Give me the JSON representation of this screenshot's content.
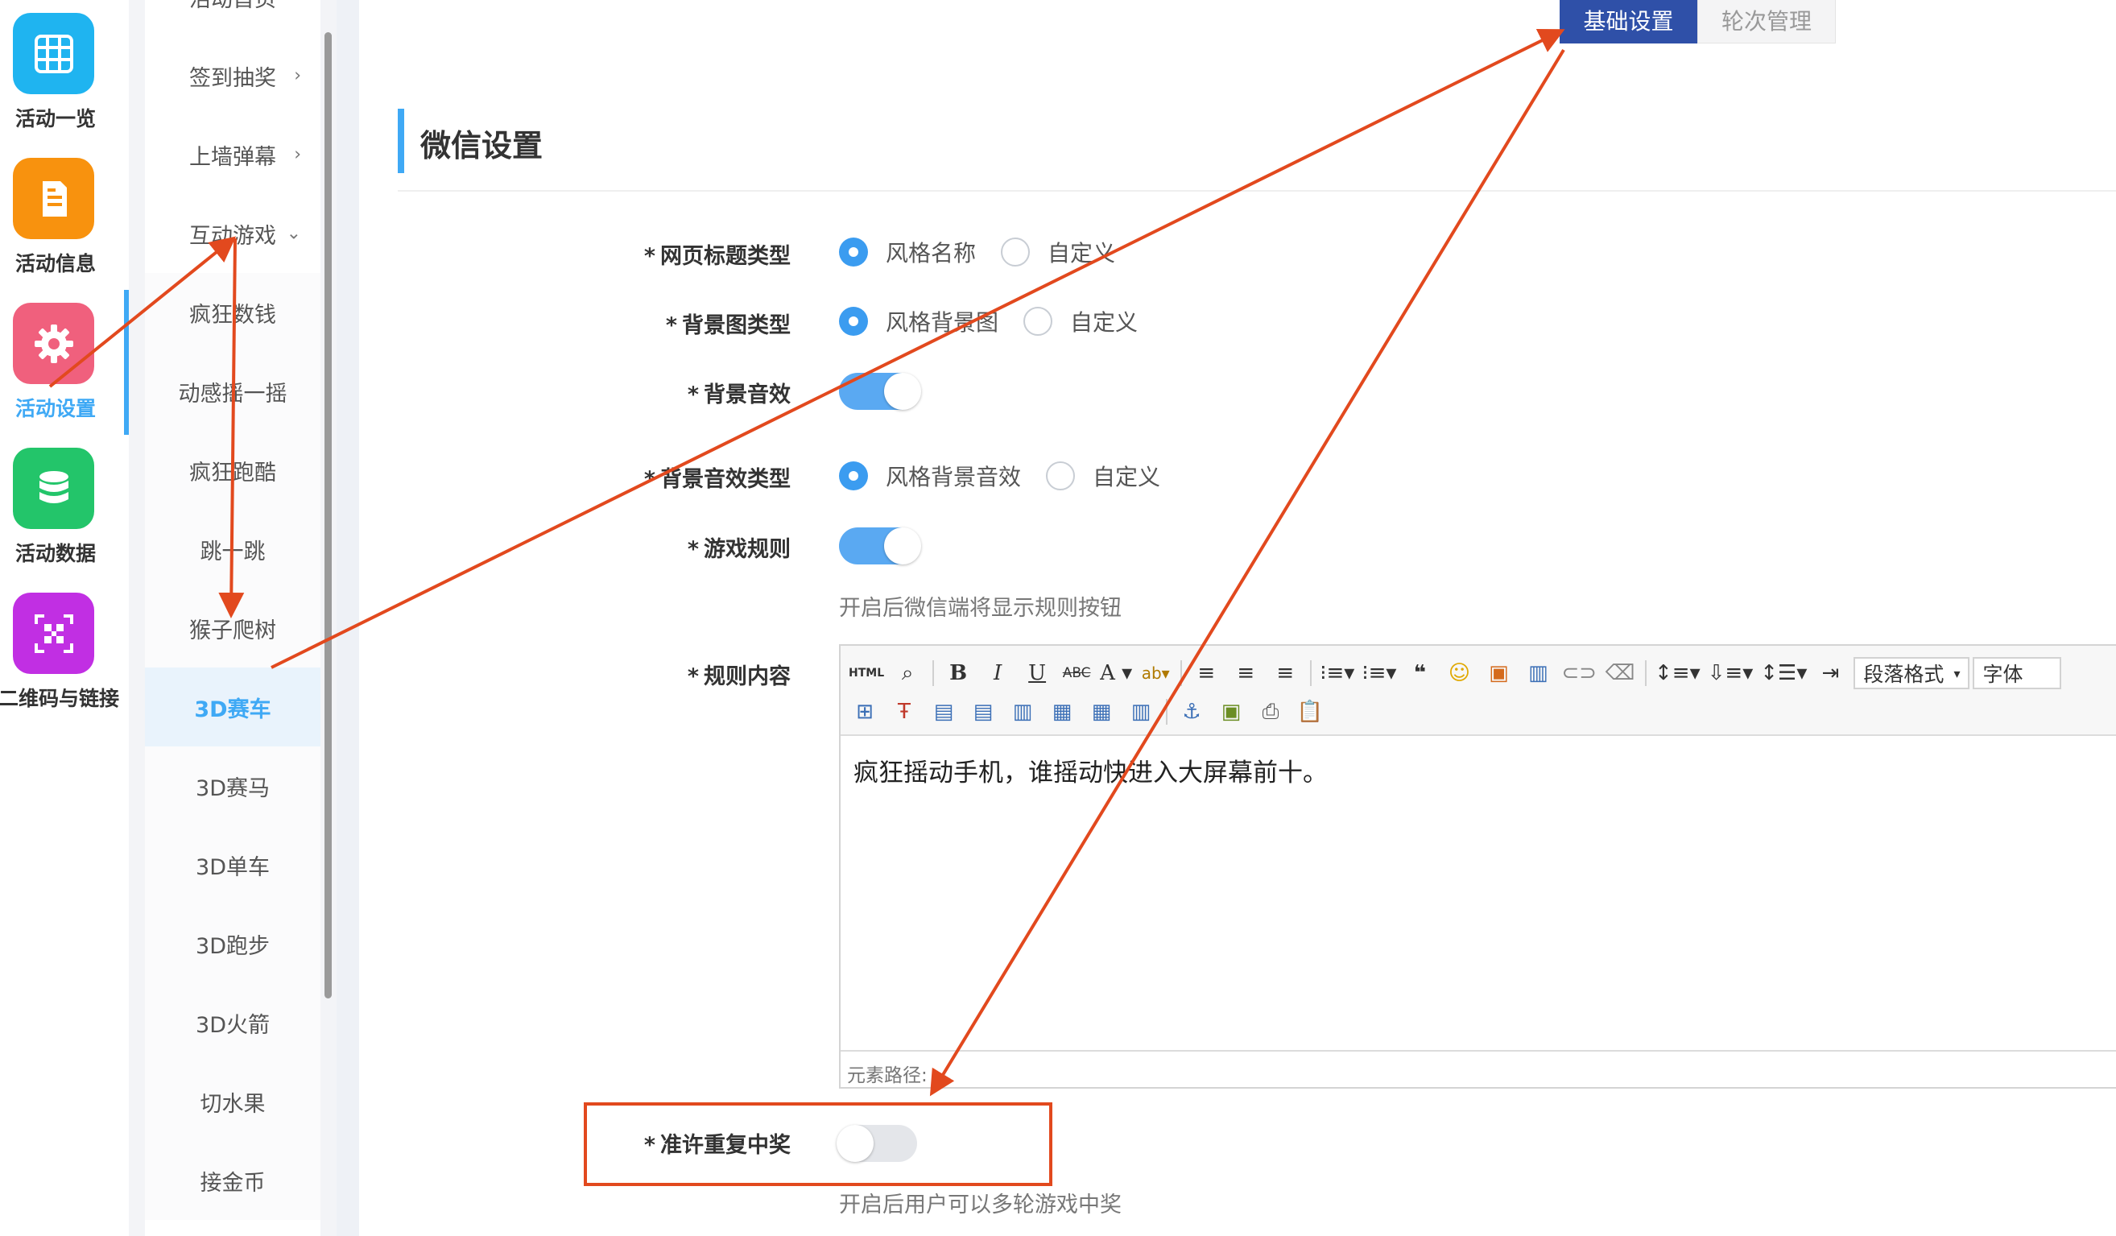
{
  "rail": {
    "items": [
      {
        "label": "活动一览",
        "color": "#1fb4f0",
        "icon": "grid-icon"
      },
      {
        "label": "活动信息",
        "color": "#f8920e",
        "icon": "document-icon"
      },
      {
        "label": "活动设置",
        "color": "#f0607d",
        "icon": "gear-icon"
      },
      {
        "label": "活动数据",
        "color": "#23c56a",
        "icon": "database-icon"
      },
      {
        "label": "二维码与链接",
        "color": "#c12fe3",
        "icon": "qrcode-icon"
      }
    ]
  },
  "submenu": {
    "items": [
      {
        "label": "活动首页"
      },
      {
        "label": "签到抽奖",
        "chevron": "›"
      },
      {
        "label": "上墙弹幕",
        "chevron": "›"
      },
      {
        "label": "互动游戏",
        "chevron": "⌄"
      }
    ],
    "games": [
      "疯狂数钱",
      "动感摇一摇",
      "疯狂跑酷",
      "跳一跳",
      "猴子爬树",
      "3D赛车",
      "3D赛马",
      "3D单车",
      "3D跑步",
      "3D火箭",
      "切水果",
      "接金币"
    ],
    "active_game": "3D赛车"
  },
  "tabs": {
    "basic": "基础设置",
    "rounds": "轮次管理"
  },
  "section": {
    "title": "微信设置"
  },
  "form": {
    "page_title_type": {
      "label": "网页标题类型",
      "options": [
        "风格名称",
        "自定义"
      ]
    },
    "bg_image_type": {
      "label": "背景图类型",
      "options": [
        "风格背景图",
        "自定义"
      ]
    },
    "bg_sound": {
      "label": "背景音效"
    },
    "bg_sound_type": {
      "label": "背景音效类型",
      "options": [
        "风格背景音效",
        "自定义"
      ]
    },
    "game_rules": {
      "label": "游戏规则",
      "hint": "开启后微信端将显示规则按钮"
    },
    "rule_content": {
      "label": "规则内容"
    },
    "allow_repeat": {
      "label": "准许重复中奖",
      "hint": "开启后用户可以多轮游戏中奖"
    },
    "required_mark": "*"
  },
  "editor": {
    "content": "疯狂摇动手机，谁摇动快进入大屏幕前十。",
    "footer": "元素路径:",
    "paragraph_select": "段落格式",
    "font_select": "字体",
    "html_btn": "HTML"
  },
  "colors": {
    "accent": "#3fa9f5",
    "tab_active": "#2f50a8",
    "annotation": "#e2491e"
  }
}
